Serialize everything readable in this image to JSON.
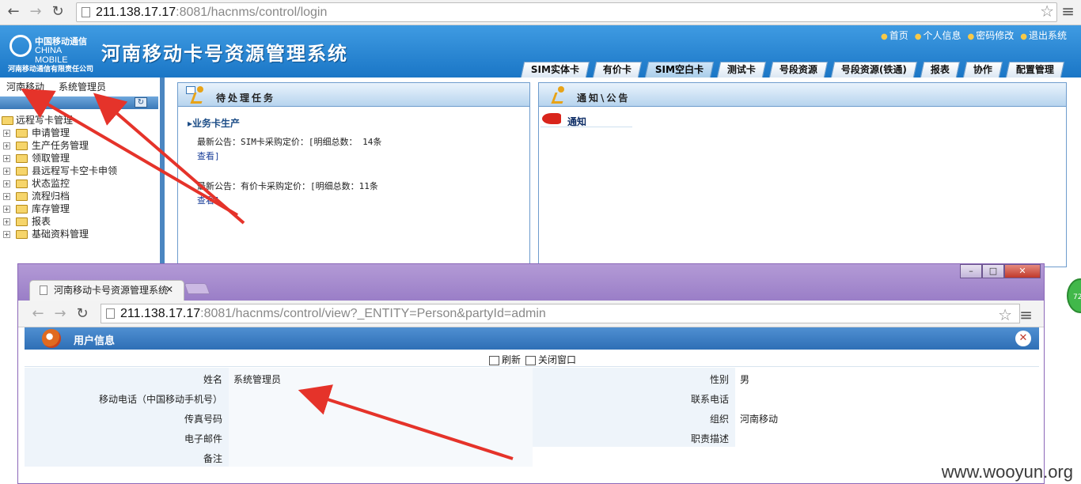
{
  "browser": {
    "url_host": "211.138.17.17",
    "url_rest": ":8081/hacnms/control/login"
  },
  "header": {
    "logo_cn": "中国移动通信",
    "logo_en": "CHINA MOBILE",
    "logo_company": "河南移动通信有限责任公司",
    "title": "河南移动卡号资源管理系统",
    "links": [
      "首页",
      "个人信息",
      "密码修改",
      "退出系统"
    ],
    "tabs": [
      "SIM实体卡",
      "有价卡",
      "SIM空白卡",
      "测试卡",
      "号段资源",
      "号段资源(铁通)",
      "报表",
      "协作",
      "配置管理"
    ],
    "active_tab": "SIM空白卡"
  },
  "sidebar": {
    "org": "河南移动",
    "user": "系统管理员",
    "root": "远程写卡管理",
    "items": [
      "申请管理",
      "生产任务管理",
      "领取管理",
      "县远程写卡空卡申领",
      "状态监控",
      "流程归档",
      "库存管理",
      "报表",
      "基础资料管理"
    ]
  },
  "tasks_panel": {
    "title": "待处理任务",
    "section": "▸业务卡生产",
    "notices": [
      {
        "text": "最新公告：SIM卡采购定价：[明细总数： 14条",
        "link": "查看]"
      },
      {
        "text": "最新公告：有价卡采购定价：[明细总数：11条",
        "link": "查看]"
      }
    ]
  },
  "notice_panel": {
    "title": "通知\\公告",
    "label": "通知"
  },
  "popup": {
    "tab_title": "河南移动卡号资源管理系统",
    "url_host": "211.138.17.17",
    "url_rest": ":8081/hacnms/control/view?_ENTITY=Person&partyId=admin",
    "header_title": "用户信息",
    "actions": [
      "刷新",
      "关闭窗口"
    ],
    "rows": [
      {
        "label": "姓名",
        "value": "系统管理员",
        "label2": "性别",
        "value2": "男"
      },
      {
        "label": "移动电话（中国移动手机号）",
        "value": "",
        "label2": "联系电话",
        "value2": ""
      },
      {
        "label": "传真号码",
        "value": "",
        "label2": "组织",
        "value2": "河南移动"
      },
      {
        "label": "电子邮件",
        "value": "",
        "label2": "职责描述",
        "value2": ""
      },
      {
        "label": "备注",
        "value": "",
        "label2": "",
        "value2": ""
      }
    ]
  },
  "watermark": "www.wooyun.org",
  "side_badge": "72"
}
